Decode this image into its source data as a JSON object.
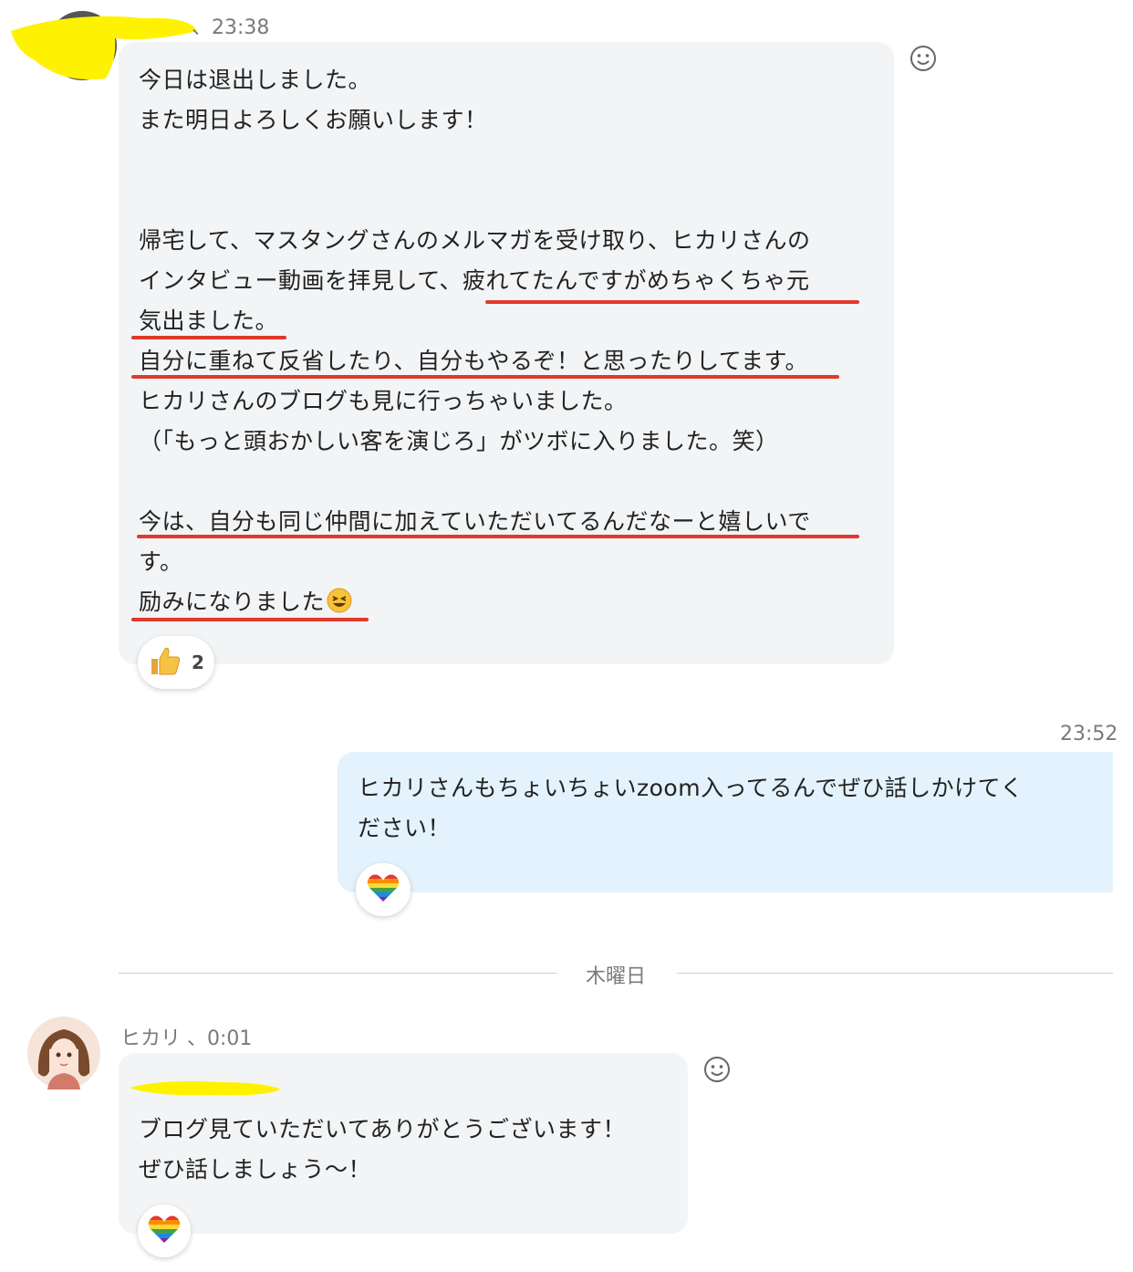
{
  "first_message": {
    "time": "、23:38",
    "lines": [
      "今日は退出しました。",
      "また明日よろしくお願いします！",
      "",
      "",
      "帰宅して、マスタングさんのメルマガを受け取り、ヒカリさんの",
      "インタビュー動画を拝見して、疲れてたんですがめちゃくちゃ元",
      "気出ました。",
      "自分に重ねて反省したり、自分もやるぞ！と思ったりしてます。",
      "ヒカリさんのブログも見に行っちゃいました。",
      "（「もっと頭おかしい客を演じろ」がツボに入りました。笑）",
      "",
      "今は、自分も同じ仲間に加えていただいてるんだなーと嬉しいで",
      "す。",
      "励みになりました"
    ],
    "reaction_icon": "thumbs-up-icon",
    "reaction_count": "2"
  },
  "second_message": {
    "time": "23:52",
    "lines": [
      "ヒカリさんもちょいちょいzoom入ってるんでぜひ話しかけてく",
      "ださい！"
    ],
    "reaction_icon": "rainbow-heart-icon"
  },
  "day_divider": "木曜日",
  "third_message": {
    "sender_meta": "ヒカリ 、0:01",
    "lines": [
      "ブログ見ていただいてありがとうございます！",
      "ぜひ話しましょう〜！"
    ],
    "reaction_icon": "rainbow-heart-icon"
  },
  "colors": {
    "incoming_bubble": "#f2f4f6",
    "outgoing_bubble": "#e3f2fc",
    "underline": "#e0392b",
    "redaction_highlight": "#fff200"
  }
}
